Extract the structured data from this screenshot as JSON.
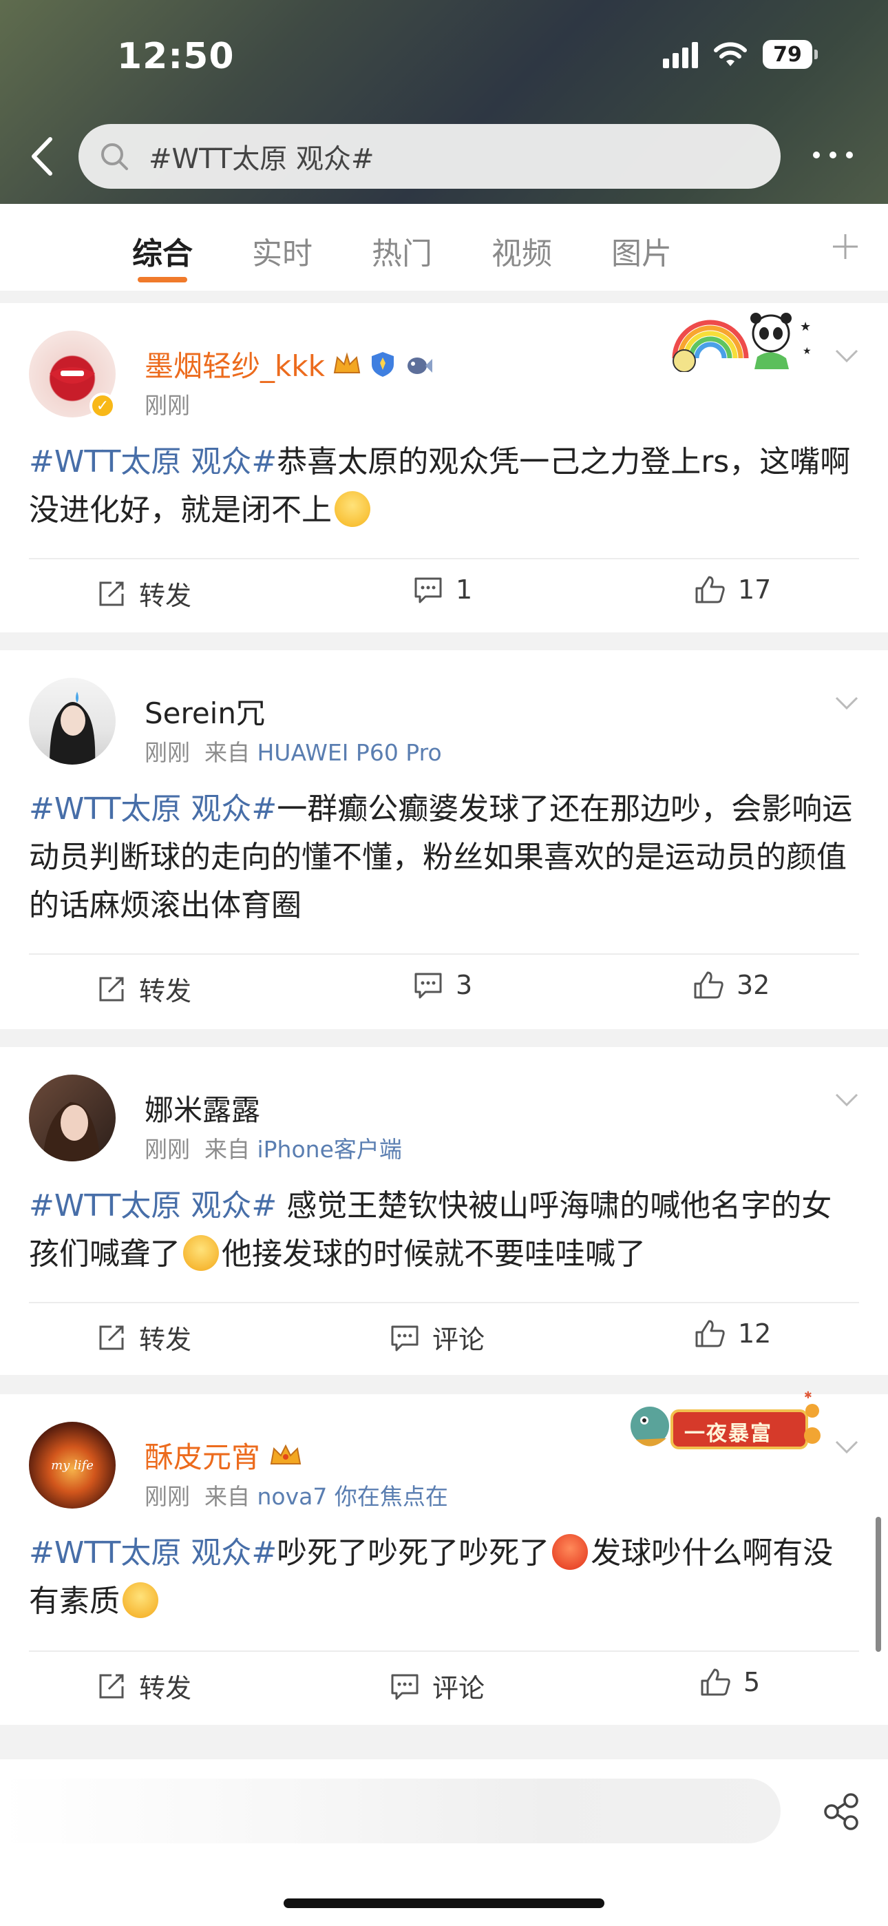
{
  "status_bar": {
    "time": "12:50",
    "battery": "79"
  },
  "search": {
    "query": "#WTT太原 观众#"
  },
  "tabs": [
    {
      "label": "综合",
      "active": true
    },
    {
      "label": "实时",
      "active": false
    },
    {
      "label": "热门",
      "active": false
    },
    {
      "label": "视频",
      "active": false
    },
    {
      "label": "图片",
      "active": false
    }
  ],
  "posts": [
    {
      "username": "墨烟轻纱_kkk",
      "time": "刚刚",
      "source_prefix": "",
      "source": "",
      "hashtag": "#WTT太原 观众#",
      "text_a": "恭喜太原的观众凭一己之力登上rs，这嘴啊没进化好，就是闭不上",
      "text_b": "",
      "repost_label": "转发",
      "comment_label": "1",
      "like_count": "17"
    },
    {
      "username": "Serein冗",
      "time": "刚刚",
      "source_prefix": "来自",
      "source": "HUAWEI P60 Pro",
      "hashtag": "#WTT太原 观众#",
      "text_a": "一群癫公癫婆发球了还在那边吵，会影响运动员判断球的走向的懂不懂，粉丝如果喜欢的是运动员的颜值的话麻烦滚出体育圈",
      "text_b": "",
      "repost_label": "转发",
      "comment_label": "3",
      "like_count": "32"
    },
    {
      "username": "娜米露露",
      "time": "刚刚",
      "source_prefix": "来自",
      "source": "iPhone客户端",
      "hashtag": "#WTT太原 观众#",
      "text_a": " 感觉王楚钦快被山呼海啸的喊他名字的女孩们喊聋了",
      "text_b": "他接发球的时候就不要哇哇喊了",
      "repost_label": "转发",
      "comment_label": "评论",
      "like_count": "12"
    },
    {
      "username": "酥皮元宵",
      "time": "刚刚",
      "source_prefix": "来自",
      "source": "nova7 你在焦点在",
      "hashtag": "#WTT太原 观众#",
      "text_a": "吵死了吵死了吵死了",
      "text_b": "发球吵什么啊有没有素质",
      "repost_label": "转发",
      "comment_label": "评论",
      "like_count": "5",
      "badge_text": "一夜暴富",
      "avatar_text": "my life"
    }
  ],
  "colors": {
    "accent": "#f07a2b",
    "hashtag": "#476ea8",
    "vip_name": "#ec6b1d",
    "source_link": "#5a7eb1"
  }
}
